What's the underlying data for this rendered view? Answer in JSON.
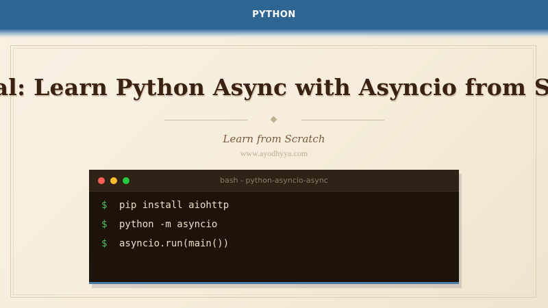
{
  "header": {
    "category": "PYTHON"
  },
  "hero": {
    "headline": "Tutorial: Learn Python Async with Asyncio from Scratch",
    "subtitle": "Learn from Scratch",
    "site_url": "www.ayodhyya.com"
  },
  "terminal": {
    "title": "bash - python-asyncio-async",
    "prompt": "$",
    "lines": [
      {
        "command": "pip install aiohttp"
      },
      {
        "command": "python -m asyncio"
      },
      {
        "command": "asyncio.run(main())"
      }
    ]
  },
  "colors": {
    "header_bar": "#2f6593",
    "background": "#f5ecdb",
    "headline": "#3a2212",
    "terminal_bg": "#1e130b",
    "prompt": "#4fbf5f",
    "dot_red": "#ff5f56",
    "dot_yellow": "#ffbd2e",
    "dot_green": "#27c93f"
  }
}
